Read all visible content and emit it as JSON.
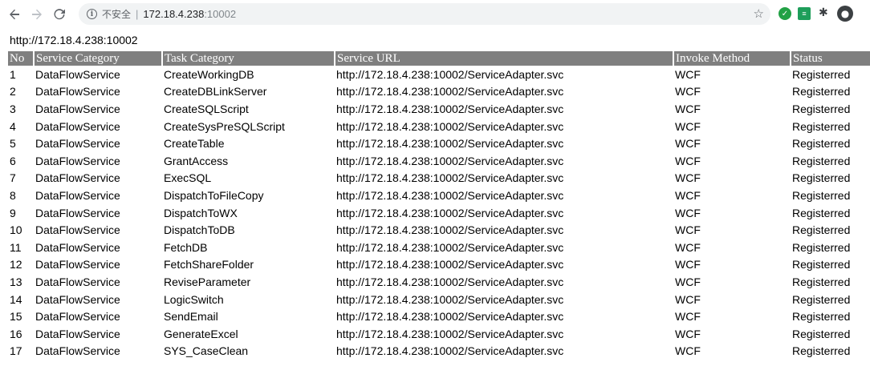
{
  "browser": {
    "security_label": "不安全",
    "separator": "|",
    "host": "172.18.4.238",
    "port": ":10002"
  },
  "page": {
    "url_heading": "http://172.18.4.238:10002"
  },
  "table": {
    "headers": [
      "No",
      "Service Category",
      "Task Category",
      "Service URL",
      "Invoke Method",
      "Status"
    ],
    "rows": [
      [
        "1",
        "DataFlowService",
        "CreateWorkingDB",
        "http://172.18.4.238:10002/ServiceAdapter.svc",
        "WCF",
        "Registerred"
      ],
      [
        "2",
        "DataFlowService",
        "CreateDBLinkServer",
        "http://172.18.4.238:10002/ServiceAdapter.svc",
        "WCF",
        "Registerred"
      ],
      [
        "3",
        "DataFlowService",
        "CreateSQLScript",
        "http://172.18.4.238:10002/ServiceAdapter.svc",
        "WCF",
        "Registerred"
      ],
      [
        "4",
        "DataFlowService",
        "CreateSysPreSQLScript",
        "http://172.18.4.238:10002/ServiceAdapter.svc",
        "WCF",
        "Registerred"
      ],
      [
        "5",
        "DataFlowService",
        "CreateTable",
        "http://172.18.4.238:10002/ServiceAdapter.svc",
        "WCF",
        "Registerred"
      ],
      [
        "6",
        "DataFlowService",
        "GrantAccess",
        "http://172.18.4.238:10002/ServiceAdapter.svc",
        "WCF",
        "Registerred"
      ],
      [
        "7",
        "DataFlowService",
        "ExecSQL",
        "http://172.18.4.238:10002/ServiceAdapter.svc",
        "WCF",
        "Registerred"
      ],
      [
        "8",
        "DataFlowService",
        "DispatchToFileCopy",
        "http://172.18.4.238:10002/ServiceAdapter.svc",
        "WCF",
        "Registerred"
      ],
      [
        "9",
        "DataFlowService",
        "DispatchToWX",
        "http://172.18.4.238:10002/ServiceAdapter.svc",
        "WCF",
        "Registerred"
      ],
      [
        "10",
        "DataFlowService",
        "DispatchToDB",
        "http://172.18.4.238:10002/ServiceAdapter.svc",
        "WCF",
        "Registerred"
      ],
      [
        "11",
        "DataFlowService",
        "FetchDB",
        "http://172.18.4.238:10002/ServiceAdapter.svc",
        "WCF",
        "Registerred"
      ],
      [
        "12",
        "DataFlowService",
        "FetchShareFolder",
        "http://172.18.4.238:10002/ServiceAdapter.svc",
        "WCF",
        "Registerred"
      ],
      [
        "13",
        "DataFlowService",
        "ReviseParameter",
        "http://172.18.4.238:10002/ServiceAdapter.svc",
        "WCF",
        "Registerred"
      ],
      [
        "14",
        "DataFlowService",
        "LogicSwitch",
        "http://172.18.4.238:10002/ServiceAdapter.svc",
        "WCF",
        "Registerred"
      ],
      [
        "15",
        "DataFlowService",
        "SendEmail",
        "http://172.18.4.238:10002/ServiceAdapter.svc",
        "WCF",
        "Registerred"
      ],
      [
        "16",
        "DataFlowService",
        "GenerateExcel",
        "http://172.18.4.238:10002/ServiceAdapter.svc",
        "WCF",
        "Registerred"
      ],
      [
        "17",
        "DataFlowService",
        "SYS_CaseClean",
        "http://172.18.4.238:10002/ServiceAdapter.svc",
        "WCF",
        "Registerred"
      ]
    ]
  },
  "icons": {
    "back": "back-arrow-icon",
    "forward": "forward-arrow-icon",
    "reload": "reload-icon",
    "info": "info-icon",
    "bookmark": "star-icon",
    "extension_1": "green-shield-extension-icon",
    "extension_2": "green-doc-extension-icon",
    "extensions": "puzzle-icon",
    "account": "account-icon"
  },
  "colors": {
    "header_bg": "#7f7f7f",
    "header_text": "#ffffff",
    "omnibox_bg": "#f1f3f4"
  }
}
